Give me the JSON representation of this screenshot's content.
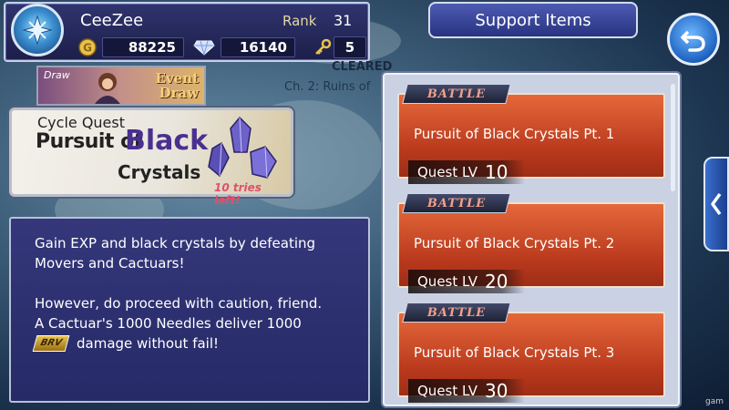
{
  "player": {
    "name": "CeeZee",
    "rank_label": "Rank",
    "rank": "31",
    "gil": "88225",
    "gems": "16140",
    "keys": "5"
  },
  "event_banner": {
    "tag": "Draw",
    "title_line1": "Event",
    "title_line2": "Draw"
  },
  "map": {
    "cleared": "CLEARED",
    "chapter": "Ch. 2: Ruins of"
  },
  "cycle_quest": {
    "subtitle": "Cycle Quest",
    "title_part1": "Pursuit of",
    "title_accent": "Black",
    "title_part2": "Crystals",
    "tries_left": "10 tries left!"
  },
  "description": {
    "line1": "Gain EXP and black crystals by defeating",
    "line2": "Movers and Cactuars!",
    "line3": "However, do proceed with caution, friend.",
    "line4": "A Cactuar's 1000 Needles deliver 1000",
    "brv_badge": "BRV",
    "line5": "damage without fail!"
  },
  "header": {
    "title": "Support Items"
  },
  "quests": [
    {
      "tag": "BATTLE",
      "title": "Pursuit of Black Crystals Pt. 1",
      "lv_label": "Quest LV",
      "lv": "10"
    },
    {
      "tag": "BATTLE",
      "title": "Pursuit of Black Crystals Pt. 2",
      "lv_label": "Quest LV",
      "lv": "20"
    },
    {
      "tag": "BATTLE",
      "title": "Pursuit of Black Crystals Pt. 3",
      "lv_label": "Quest LV",
      "lv": "30"
    }
  ],
  "watermark": "gam",
  "icons": {
    "emblem": "crystal-emblem-icon",
    "gil": "gil-coin-icon",
    "gem": "gem-icon",
    "key": "key-icon",
    "back": "back-arrow-icon",
    "side": "chevron-left-icon"
  },
  "colors": {
    "accent": "#4a2f8f",
    "quest_card": "#c8431f",
    "panel": "#2c2f6e"
  }
}
